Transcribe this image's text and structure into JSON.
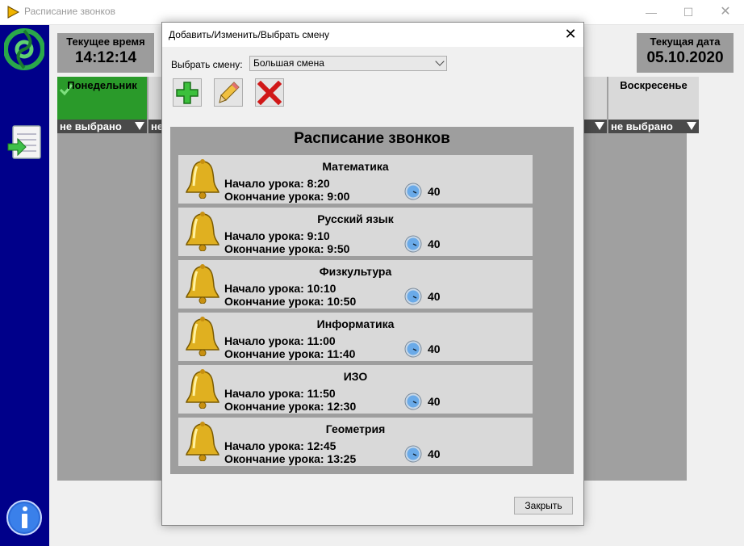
{
  "window": {
    "title": "Расписание звонков"
  },
  "current_time": {
    "label": "Текущее время",
    "value": "14:12:14"
  },
  "current_date": {
    "label": "Текущая дата",
    "value": "05.10.2020"
  },
  "days": [
    {
      "name": "Понедельник",
      "select": "не выбрано"
    },
    {
      "name": "",
      "select": "не"
    },
    {
      "name": "",
      "select": ""
    },
    {
      "name": "Воскресенье",
      "select": "не выбрано"
    }
  ],
  "dialog": {
    "title": "Добавить/Изменить/Выбрать смену",
    "shift_label": "Выбрать смену:",
    "shift_value": "Большая смена",
    "schedule_title": "Расписание звонков",
    "close_label": "Закрыть",
    "lessons": [
      {
        "name": "Математика",
        "start": "Начало урока: 8:20",
        "end": "Окончание урока: 9:00",
        "duration": "40"
      },
      {
        "name": "Русский язык",
        "start": "Начало урока: 9:10",
        "end": "Окончание урока: 9:50",
        "duration": "40"
      },
      {
        "name": "Физкультура",
        "start": "Начало урока: 10:10",
        "end": "Окончание урока: 10:50",
        "duration": "40"
      },
      {
        "name": "Информатика",
        "start": "Начало урока: 11:00",
        "end": "Окончание урока: 11:40",
        "duration": "40"
      },
      {
        "name": "ИЗО",
        "start": "Начало урока: 11:50",
        "end": "Окончание урока: 12:30",
        "duration": "40"
      },
      {
        "name": "Геометрия",
        "start": "Начало урока: 12:45",
        "end": "Окончание урока: 13:25",
        "duration": "40"
      }
    ]
  },
  "colors": {
    "sidebar": "#00008a",
    "active_day": "#2a9a2a",
    "panel": "#9e9e9e",
    "lesson_bg": "#d9d9d9"
  },
  "icons": [
    "app-icon",
    "logo-icon",
    "schedule-icon",
    "info-icon",
    "check-icon",
    "add-icon",
    "edit-icon",
    "delete-icon",
    "bell-icon",
    "clock-icon"
  ]
}
